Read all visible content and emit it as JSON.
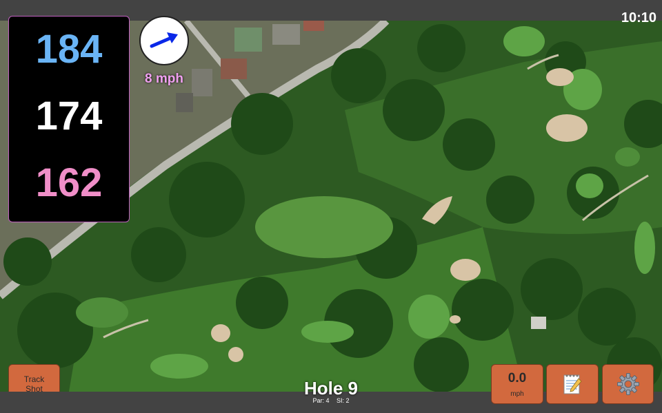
{
  "status": {
    "time": "10:10"
  },
  "distances": {
    "back": "184",
    "center": "174",
    "front": "162"
  },
  "wind": {
    "speed_label": "8 mph"
  },
  "buttons": {
    "track_shot_line1": "Track",
    "track_shot_line2": "Shot",
    "wind_value": "0.0",
    "wind_unit": "mph",
    "notes_icon": "notepad-icon",
    "settings_icon": "gear-icon"
  },
  "hole": {
    "title": "Hole 9",
    "par": "Par: 4",
    "si": "SI: 2"
  },
  "colors": {
    "back": "#6ab4f5",
    "center": "#ffffff",
    "front": "#f08ec8",
    "button": "#d2693e",
    "wind_arrow": "#0a28e8"
  }
}
